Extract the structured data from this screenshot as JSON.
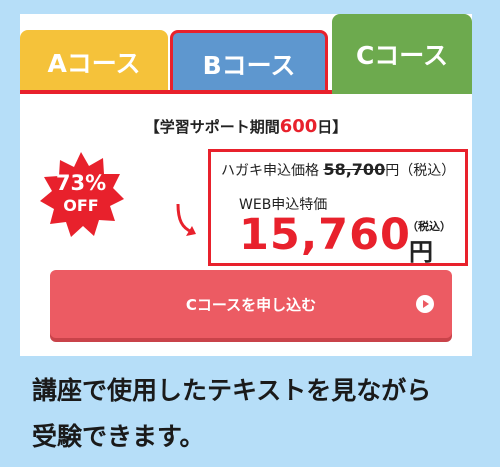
{
  "tabs": [
    {
      "label": "Aコース"
    },
    {
      "label": "Bコース"
    },
    {
      "label": "Cコース"
    }
  ],
  "period": {
    "prefix": "【学習サポート期間",
    "days": "600",
    "suffix": "日】"
  },
  "discount": {
    "percent": "73%",
    "off": "OFF"
  },
  "pricing": {
    "hagaki_label": "ハガキ申込価格",
    "hagaki_price": "58,700",
    "hagaki_suffix": "円（税込）",
    "web_label": "WEB申込特価",
    "web_price": "15,760",
    "web_tax": "（税込）",
    "web_yen": "円"
  },
  "cta": {
    "label": "Cコースを申し込む"
  },
  "caption": {
    "line1": "講座で使用したテキストを見ながら",
    "line2": "受験できます。"
  },
  "colors": {
    "tab_a": "#f5c23a",
    "tab_b": "#5e97cf",
    "tab_c": "#6daa4e",
    "accent_red": "#e8212c",
    "cta": "#ec5b63",
    "background": "#b6def8"
  }
}
